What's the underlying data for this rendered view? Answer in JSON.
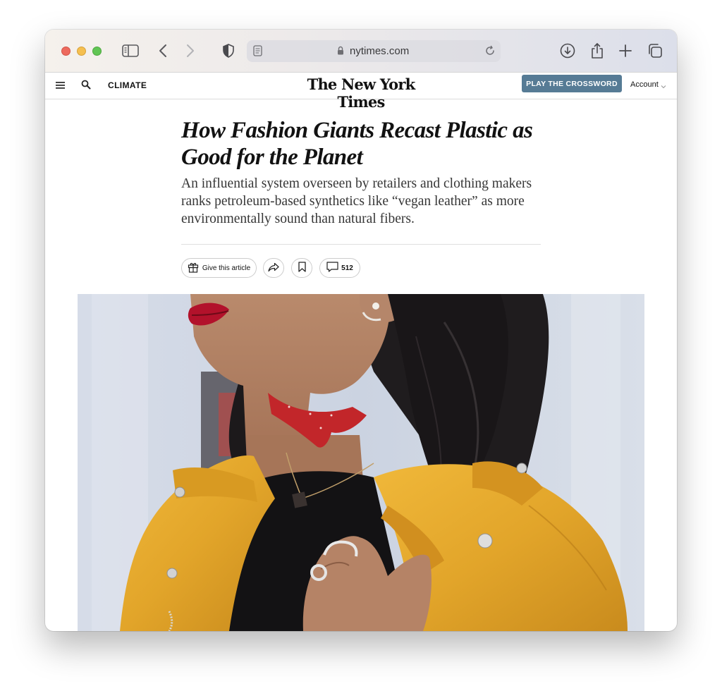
{
  "browser": {
    "url": "nytimes.com",
    "icons": {
      "sidebar": "sidebar-icon",
      "back": "back-chevron-icon",
      "forward": "forward-chevron-icon",
      "privacy": "shield-icon",
      "reader": "reader-icon",
      "lock": "lock-icon",
      "reload": "reload-icon",
      "downloads": "download-icon",
      "share": "share-icon",
      "new_tab": "plus-icon",
      "tabs": "tab-overview-icon"
    }
  },
  "nyt_header": {
    "section": "CLIMATE",
    "masthead": "The New York Times",
    "crossword_button": "PLAY THE CROSSWORD",
    "account": "Account",
    "crossword_color": "#567b95"
  },
  "article": {
    "headline": "How Fashion Giants Recast Plastic as Good for the Planet",
    "summary": "An influential system overseen by retailers and clothing makers ranks petroleum-based synthetics like “vegan leather” as more environmentally sound than natural fibers.",
    "gift_label": "Give this article",
    "comment_count": "512",
    "photo": {
      "subject": "woman in mustard-yellow faux leather jacket with red bandana and pendant necklace",
      "accent_color": "#e2a52a"
    }
  }
}
